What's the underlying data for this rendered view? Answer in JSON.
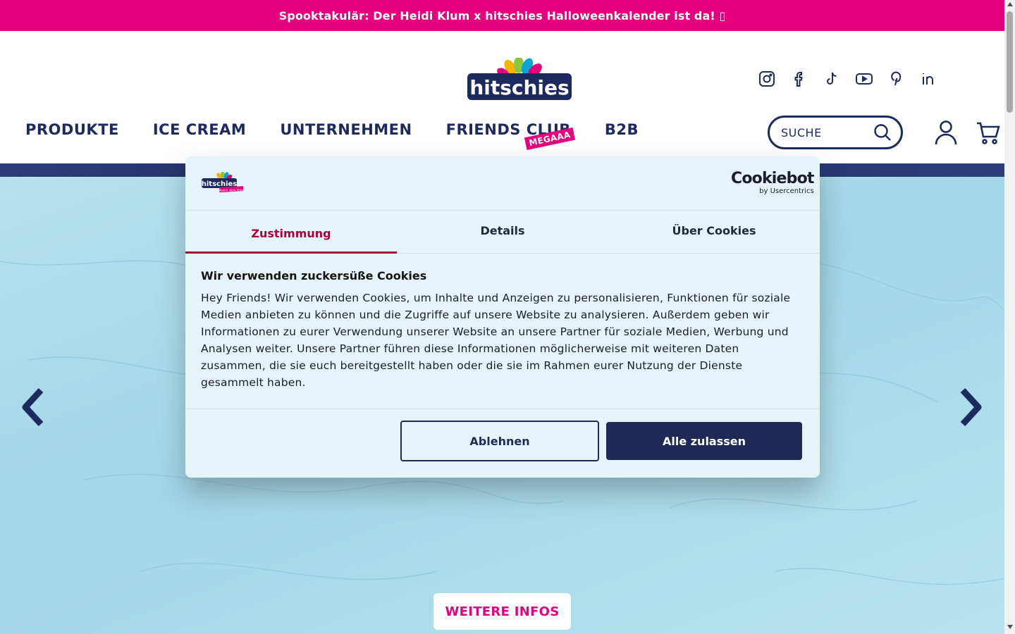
{
  "announcement": {
    "text": "Spooktakulär: Der Heidi Klum x hitschies Halloweenkalender ist da! ▯"
  },
  "header": {
    "logo_text": "hitschies",
    "social": [
      "instagram-icon",
      "facebook-icon",
      "tiktok-icon",
      "youtube-icon",
      "pinterest-icon",
      "linkedin-icon"
    ],
    "nav": [
      {
        "label": "PRODUKTE"
      },
      {
        "label": "ICE CREAM"
      },
      {
        "label": "UNTERNEHMEN"
      },
      {
        "label": "FRIENDS CLUB",
        "badge": "MEGAAA"
      },
      {
        "label": "B2B"
      }
    ],
    "search_label": "SUCHE"
  },
  "hero": {
    "more_button": "WEITERE INFOS"
  },
  "cookie_dialog": {
    "brand_logo_text": "hitschies",
    "brand_tagline": "Nasch dein Ding",
    "provider_name": "Cookiebot",
    "provider_sub": "by Usercentrics",
    "tabs": [
      {
        "label": "Zustimmung",
        "active": true
      },
      {
        "label": "Details",
        "active": false
      },
      {
        "label": "Über Cookies",
        "active": false
      }
    ],
    "title": "Wir verwenden zuckersüße Cookies",
    "text": "Hey Friends! Wir verwenden Cookies, um Inhalte und Anzeigen zu personalisieren, Funktionen für soziale Medien anbieten zu können und die Zugriffe auf unsere Website zu analysieren. Außerdem geben wir Informationen zu eurer Verwendung unserer Website an unsere Partner für soziale Medien, Werbung und Analysen weiter. Unsere Partner führen diese Informationen möglicherweise mit weiteren Daten zusammen, die sie euch bereitgestellt haben oder die sie im Rahmen eurer Nutzung der Dienste gesammelt haben.",
    "decline_label": "Ablehnen",
    "accept_label": "Alle zulassen"
  },
  "colors": {
    "brand_pink": "#e5007d",
    "brand_navy": "#1c2a5e",
    "active_tab": "#b00035",
    "accept_button": "#1e2a55"
  }
}
